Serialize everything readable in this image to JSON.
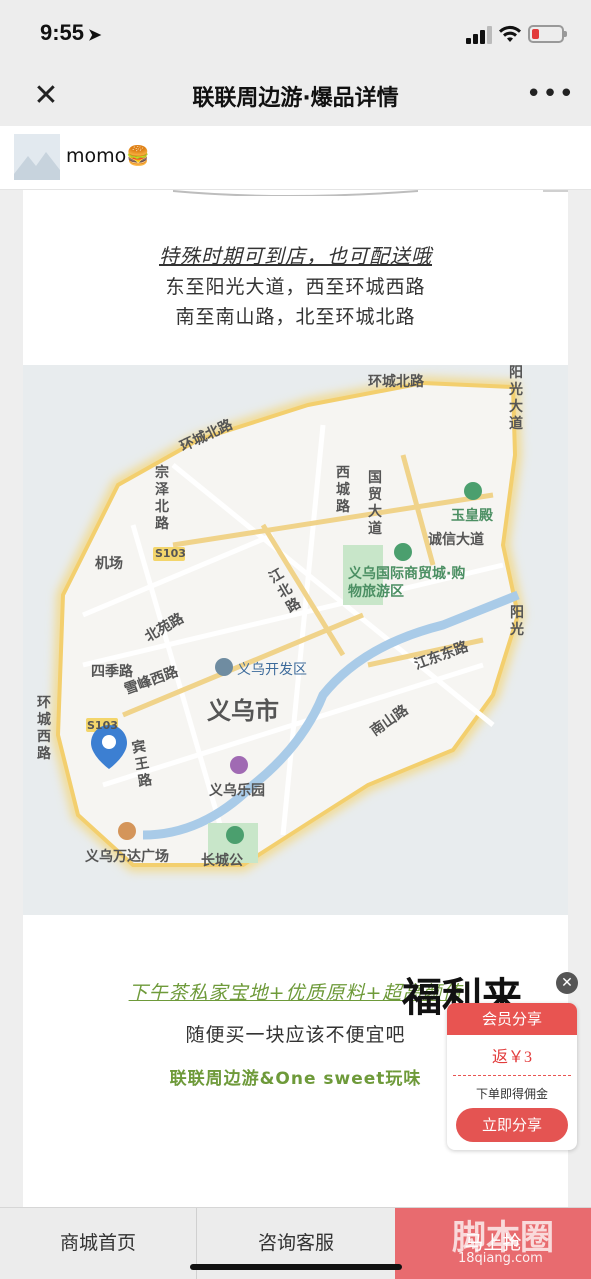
{
  "status_bar": {
    "time": "9:55",
    "battery_level": 0.25
  },
  "nav": {
    "close_icon": "close-icon",
    "title": "联联周边游·爆品详情",
    "more_icon": "more-icon"
  },
  "profile": {
    "name": "momo🍔"
  },
  "article": {
    "line1": "特殊时期可到店，也可配送哦",
    "line2": "东至阳光大道，西至环城西路",
    "line3": "南至南山路，北至环城北路",
    "line4": "下午茶私家宝地+优质原料+超高颜值",
    "line5": "随便买一块应该不便宜吧",
    "line6": "联联周边游&One sweet玩味",
    "fuli": "福利来"
  },
  "map": {
    "labels": {
      "huancheng_bei_top": "环城北路",
      "yangguang_dadao_top": "阳光大道",
      "huancheng_bei_left": "环城北路",
      "zongze_bei": "宗泽北路",
      "xicheng_lu": "西城路",
      "guomao_dadao": "国贸大道",
      "yuhuangdian": "玉皇殿",
      "chengxin_dadao": "诚信大道",
      "jichang": "机场",
      "s103": "S103",
      "intl_trade_city": "义乌国际商贸城·购物旅游区",
      "jiangbei_lu": "江北路",
      "yangguang_right": "阳光",
      "beiyuan_lu": "北苑路",
      "siji_lu": "四季路",
      "xuefeng_xilu": "雪峰西路",
      "kaifaqu": "义乌开发区",
      "jiangdong_donglu": "江东东路",
      "huancheng_xilu": "环城西路",
      "city": "义乌市",
      "nanshan_lu": "南山路",
      "s103_2": "S103",
      "binwang_lu": "宾王路",
      "leyuan": "义乌乐园",
      "wanda": "义乌万达广场",
      "changcheng": "长城公"
    }
  },
  "share": {
    "close_icon": "close-icon",
    "title": "会员分享",
    "rebate": "返￥3",
    "note": "下单即得佣金",
    "button": "立即分享"
  },
  "tabs": {
    "home": "商城首页",
    "service": "咨询客服",
    "third": "马上抢"
  },
  "watermark": {
    "text": "脚本圈",
    "url": "18qiang.com"
  }
}
